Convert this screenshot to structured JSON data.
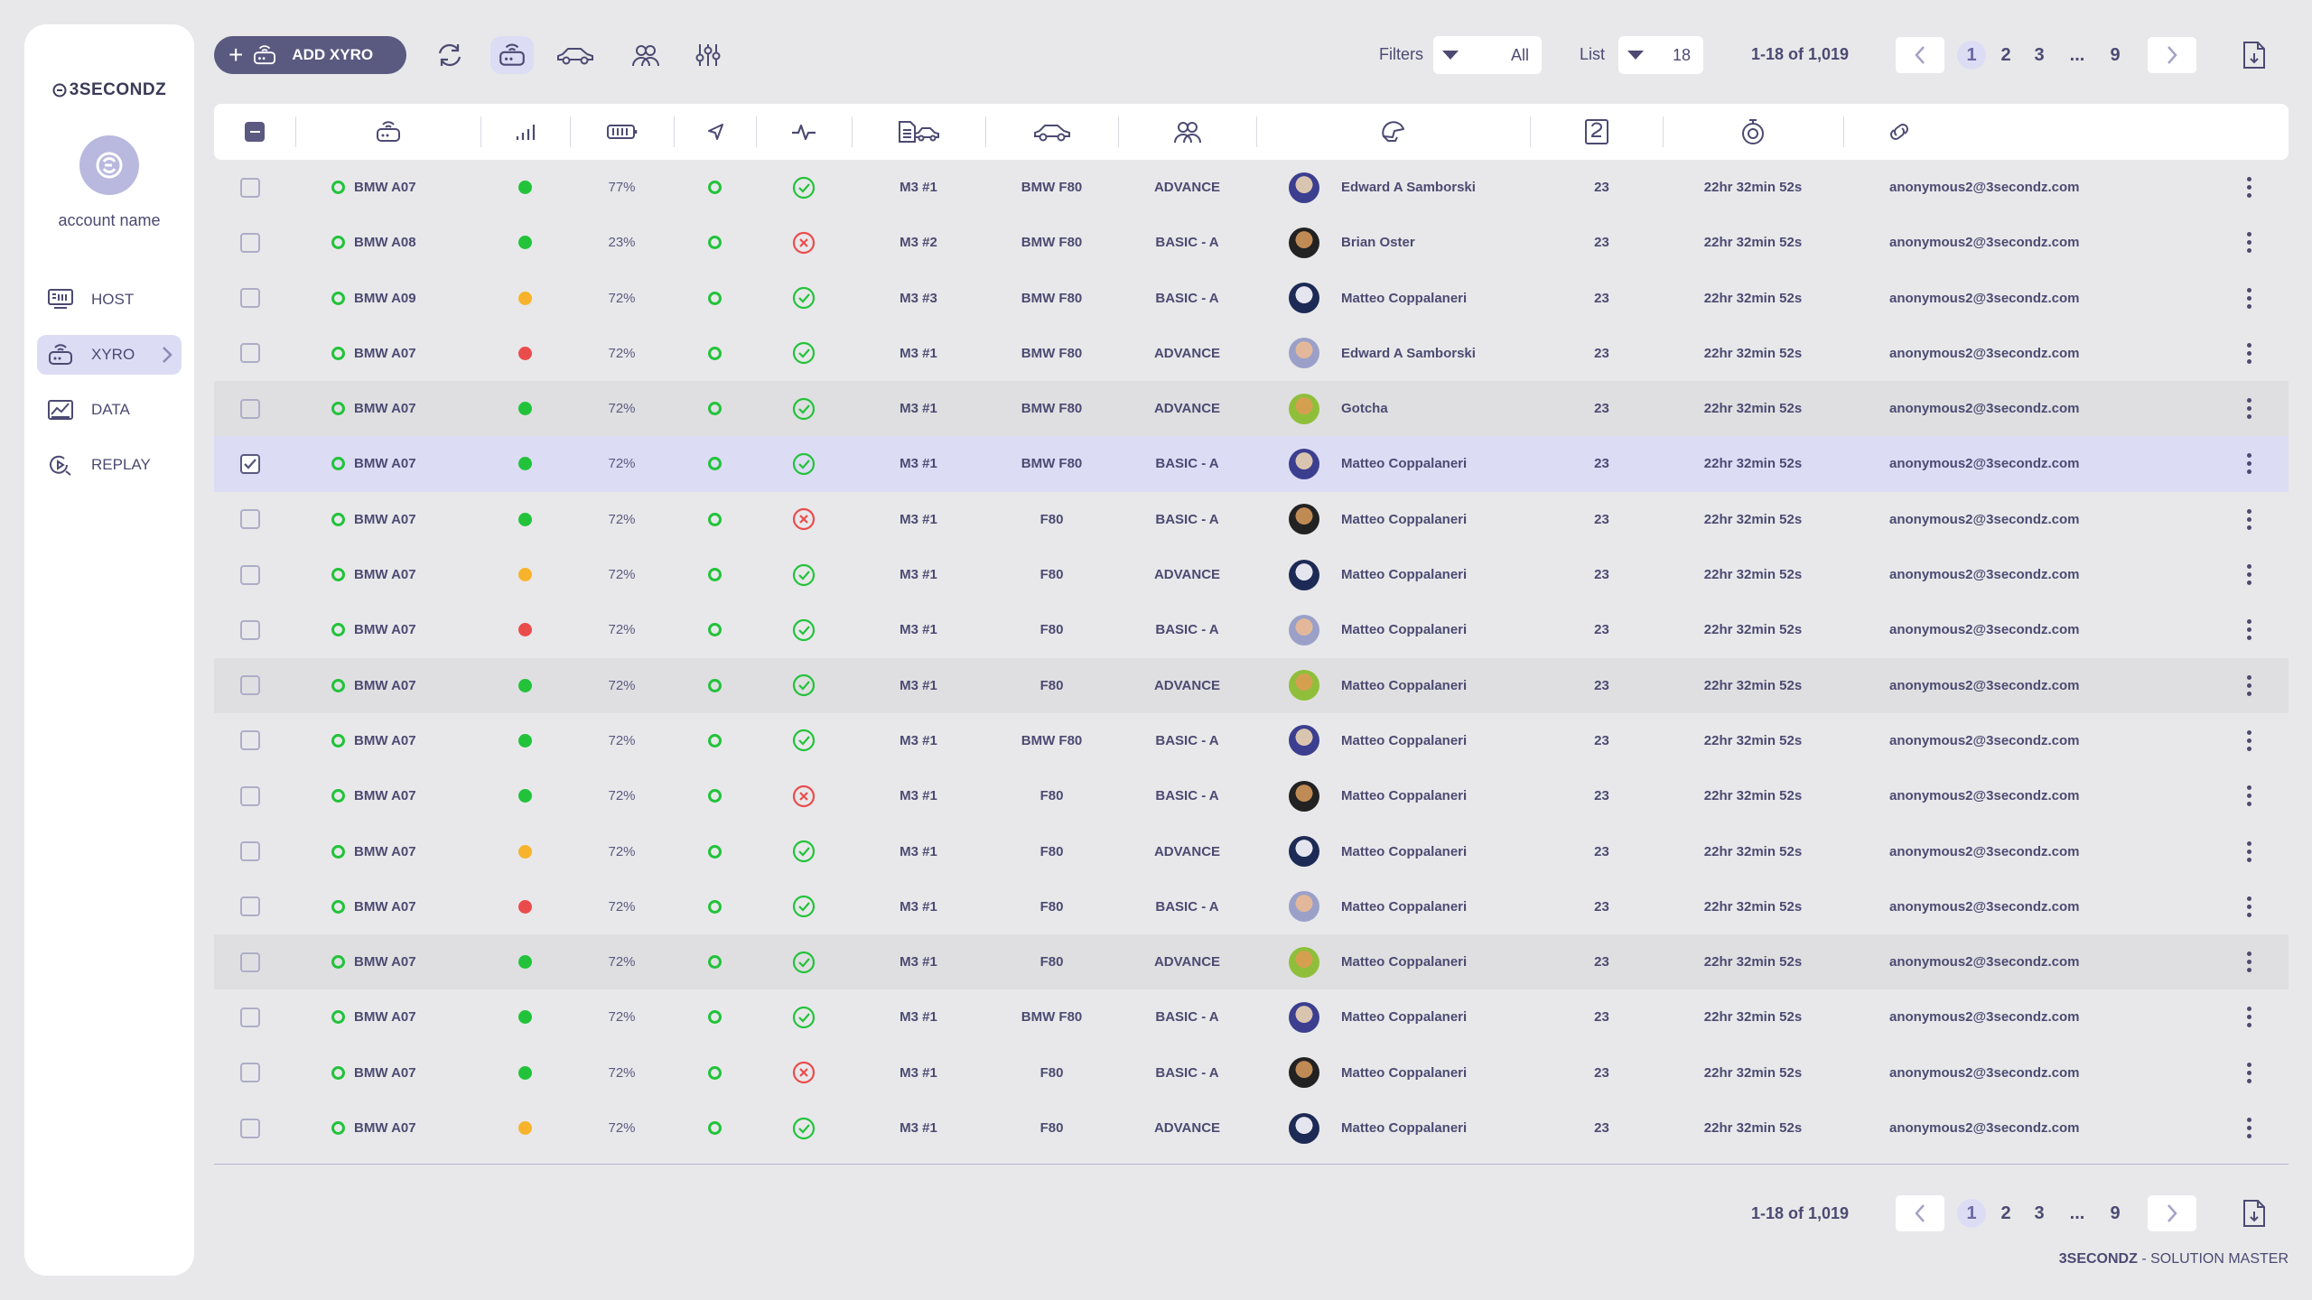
{
  "brand": {
    "logo_text": "3SECONDZ"
  },
  "account": {
    "name": "account name"
  },
  "sidebar": {
    "items": [
      {
        "label": "HOST",
        "icon": "host-icon"
      },
      {
        "label": "XYRO",
        "icon": "xyro-icon",
        "active": true
      },
      {
        "label": "DATA",
        "icon": "data-icon"
      },
      {
        "label": "REPLAY",
        "icon": "replay-icon"
      }
    ]
  },
  "toolbar": {
    "add_label": "ADD XYRO",
    "filters_label": "Filters",
    "filters_value": "All",
    "list_label": "List",
    "list_value": "18"
  },
  "pagination": {
    "range": "1-18 of 1,019",
    "pages": [
      "1",
      "2",
      "3",
      "...",
      "9"
    ],
    "current": "1"
  },
  "table": {
    "rows": [
      {
        "device": "BMW A07",
        "signal": "green",
        "battery": "77%",
        "health": "ok",
        "session": "M3 #1",
        "car": "BMW F80",
        "level": "ADVANCE",
        "avatar": "a1",
        "user": "Edward A Samborski",
        "count": "23",
        "time": "22hr 32min 52s",
        "email": "anonymous2@3secondz.com"
      },
      {
        "device": "BMW A08",
        "signal": "green",
        "battery": "23%",
        "health": "error",
        "session": "M3 #2",
        "car": "BMW F80",
        "level": "BASIC - A",
        "avatar": "a2",
        "user": "Brian Oster",
        "count": "23",
        "time": "22hr 32min 52s",
        "email": "anonymous2@3secondz.com"
      },
      {
        "device": "BMW A09",
        "signal": "orange",
        "battery": "72%",
        "health": "ok",
        "session": "M3 #3",
        "car": "BMW F80",
        "level": "BASIC - A",
        "avatar": "a3",
        "user": "Matteo Coppalaneri",
        "count": "23",
        "time": "22hr 32min 52s",
        "email": "anonymous2@3secondz.com"
      },
      {
        "device": "BMW A07",
        "signal": "red",
        "battery": "72%",
        "health": "ok",
        "session": "M3 #1",
        "car": "BMW F80",
        "level": "ADVANCE",
        "avatar": "a4",
        "user": "Edward A Samborski",
        "count": "23",
        "time": "22hr 32min 52s",
        "email": "anonymous2@3secondz.com"
      },
      {
        "device": "BMW A07",
        "signal": "green",
        "battery": "72%",
        "health": "ok",
        "session": "M3 #1",
        "car": "BMW F80",
        "level": "ADVANCE",
        "avatar": "a5",
        "user": "Gotcha",
        "count": "23",
        "time": "22hr 32min 52s",
        "email": "anonymous2@3secondz.com"
      },
      {
        "device": "BMW A07",
        "signal": "green",
        "battery": "72%",
        "health": "ok",
        "session": "M3 #1",
        "car": "BMW F80",
        "level": "BASIC - A",
        "avatar": "a1",
        "user": "Matteo Coppalaneri",
        "count": "23",
        "time": "22hr 32min 52s",
        "email": "anonymous2@3secondz.com",
        "selected": true
      },
      {
        "device": "BMW A07",
        "signal": "green",
        "battery": "72%",
        "health": "error",
        "session": "M3 #1",
        "car": "F80",
        "level": "BASIC - A",
        "avatar": "a2",
        "user": "Matteo Coppalaneri",
        "count": "23",
        "time": "22hr 32min 52s",
        "email": "anonymous2@3secondz.com"
      },
      {
        "device": "BMW A07",
        "signal": "orange",
        "battery": "72%",
        "health": "ok",
        "session": "M3 #1",
        "car": "F80",
        "level": "ADVANCE",
        "avatar": "a3",
        "user": "Matteo Coppalaneri",
        "count": "23",
        "time": "22hr 32min 52s",
        "email": "anonymous2@3secondz.com"
      },
      {
        "device": "BMW A07",
        "signal": "red",
        "battery": "72%",
        "health": "ok",
        "session": "M3 #1",
        "car": "F80",
        "level": "BASIC - A",
        "avatar": "a4",
        "user": "Matteo Coppalaneri",
        "count": "23",
        "time": "22hr 32min 52s",
        "email": "anonymous2@3secondz.com"
      },
      {
        "device": "BMW A07",
        "signal": "green",
        "battery": "72%",
        "health": "ok",
        "session": "M3 #1",
        "car": "F80",
        "level": "ADVANCE",
        "avatar": "a5",
        "user": "Matteo Coppalaneri",
        "count": "23",
        "time": "22hr 32min 52s",
        "email": "anonymous2@3secondz.com"
      },
      {
        "device": "BMW A07",
        "signal": "green",
        "battery": "72%",
        "health": "ok",
        "session": "M3 #1",
        "car": "BMW F80",
        "level": "BASIC - A",
        "avatar": "a1",
        "user": "Matteo Coppalaneri",
        "count": "23",
        "time": "22hr 32min 52s",
        "email": "anonymous2@3secondz.com"
      },
      {
        "device": "BMW A07",
        "signal": "green",
        "battery": "72%",
        "health": "error",
        "session": "M3 #1",
        "car": "F80",
        "level": "BASIC - A",
        "avatar": "a2",
        "user": "Matteo Coppalaneri",
        "count": "23",
        "time": "22hr 32min 52s",
        "email": "anonymous2@3secondz.com"
      },
      {
        "device": "BMW A07",
        "signal": "orange",
        "battery": "72%",
        "health": "ok",
        "session": "M3 #1",
        "car": "F80",
        "level": "ADVANCE",
        "avatar": "a3",
        "user": "Matteo Coppalaneri",
        "count": "23",
        "time": "22hr 32min 52s",
        "email": "anonymous2@3secondz.com"
      },
      {
        "device": "BMW A07",
        "signal": "red",
        "battery": "72%",
        "health": "ok",
        "session": "M3 #1",
        "car": "F80",
        "level": "BASIC - A",
        "avatar": "a4",
        "user": "Matteo Coppalaneri",
        "count": "23",
        "time": "22hr 32min 52s",
        "email": "anonymous2@3secondz.com"
      },
      {
        "device": "BMW A07",
        "signal": "green",
        "battery": "72%",
        "health": "ok",
        "session": "M3 #1",
        "car": "F80",
        "level": "ADVANCE",
        "avatar": "a5",
        "user": "Matteo Coppalaneri",
        "count": "23",
        "time": "22hr 32min 52s",
        "email": "anonymous2@3secondz.com"
      },
      {
        "device": "BMW A07",
        "signal": "green",
        "battery": "72%",
        "health": "ok",
        "session": "M3 #1",
        "car": "BMW F80",
        "level": "BASIC - A",
        "avatar": "a1",
        "user": "Matteo Coppalaneri",
        "count": "23",
        "time": "22hr 32min 52s",
        "email": "anonymous2@3secondz.com"
      },
      {
        "device": "BMW A07",
        "signal": "green",
        "battery": "72%",
        "health": "error",
        "session": "M3 #1",
        "car": "F80",
        "level": "BASIC - A",
        "avatar": "a2",
        "user": "Matteo Coppalaneri",
        "count": "23",
        "time": "22hr 32min 52s",
        "email": "anonymous2@3secondz.com"
      },
      {
        "device": "BMW A07",
        "signal": "orange",
        "battery": "72%",
        "health": "ok",
        "session": "M3 #1",
        "car": "F80",
        "level": "ADVANCE",
        "avatar": "a3",
        "user": "Matteo Coppalaneri",
        "count": "23",
        "time": "22hr 32min 52s",
        "email": "anonymous2@3secondz.com"
      }
    ]
  },
  "colors": {
    "green": "#22c33a",
    "orange": "#f7b32b",
    "red": "#ea4c4c",
    "accent": "#5a5980",
    "selected_row": "#dcdcf5"
  },
  "footer": {
    "brand": "3SECONDZ",
    "suffix": " - SOLUTION MASTER"
  }
}
